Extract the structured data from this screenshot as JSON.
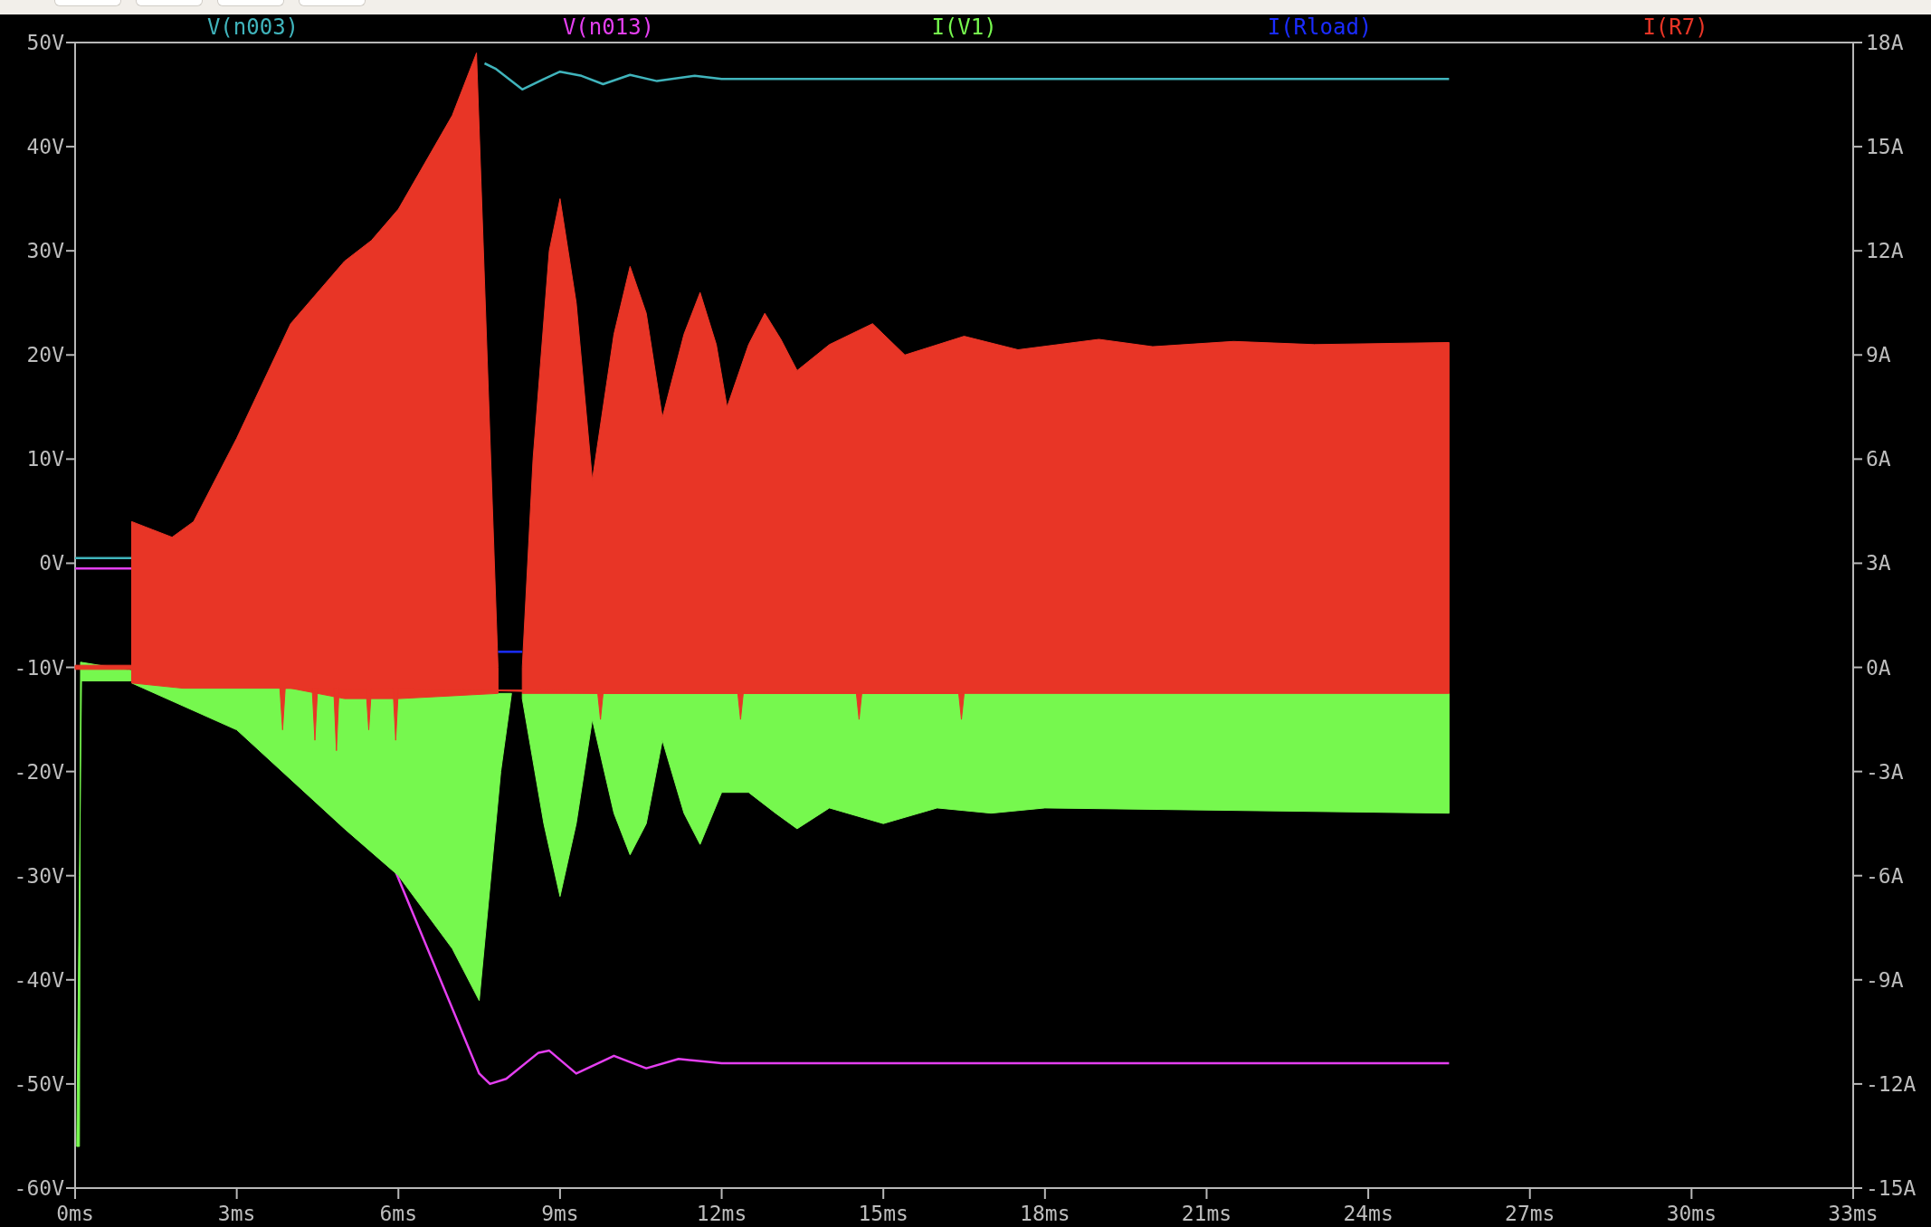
{
  "plot": {
    "traces": [
      {
        "label": "V(n003)",
        "color": "#40b4bc"
      },
      {
        "label": "V(n013)",
        "color": "#e43ff0"
      },
      {
        "label": "I(V1)",
        "color": "#76f84e"
      },
      {
        "label": "I(Rload)",
        "color": "#1a2cff"
      },
      {
        "label": "I(R7)",
        "color": "#e83526"
      }
    ],
    "y_left_ticks": [
      "50V",
      "40V",
      "30V",
      "20V",
      "10V",
      "0V",
      "-10V",
      "-20V",
      "-30V",
      "-40V",
      "-50V",
      "-60V"
    ],
    "y_right_ticks": [
      "18A",
      "15A",
      "12A",
      "9A",
      "6A",
      "3A",
      "0A",
      "-3A",
      "-6A",
      "-9A",
      "-12A",
      "-15A"
    ],
    "x_ticks": [
      "0ms",
      "3ms",
      "6ms",
      "9ms",
      "12ms",
      "15ms",
      "18ms",
      "21ms",
      "24ms",
      "27ms",
      "30ms",
      "33ms"
    ]
  }
}
